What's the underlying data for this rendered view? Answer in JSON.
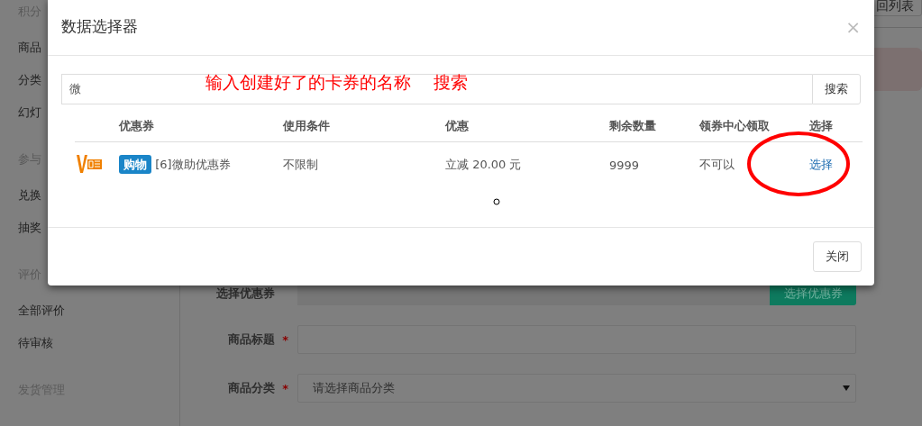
{
  "sidebar": {
    "sections": [
      {
        "title": "积分",
        "items": [
          "商品",
          "分类",
          "幻灯"
        ]
      },
      {
        "title": "参与",
        "items": [
          "兑换",
          "抽奖"
        ]
      },
      {
        "title": "评价",
        "items": [
          "全部评价",
          "待审核"
        ]
      },
      {
        "title": "发货管理"
      }
    ]
  },
  "header": {
    "back_button": "回列表"
  },
  "form": {
    "fields": [
      {
        "kind": "picker",
        "label": "选择优惠券",
        "button": "选择优惠券"
      },
      {
        "kind": "text",
        "label": "商品标题",
        "required_mark": "*"
      },
      {
        "kind": "select",
        "label": "商品分类",
        "required_mark": "*",
        "value": "请选择商品分类"
      }
    ]
  },
  "modal": {
    "title": "数据选择器",
    "close": "×",
    "search": {
      "value": "微",
      "button": "搜索"
    },
    "annotation": "输入创建好了的卡券的名称　 搜索",
    "table": {
      "columns": [
        "优惠券",
        "使用条件",
        "优惠",
        "剩余数量",
        "领券中心领取",
        "选择"
      ],
      "rows": [
        {
          "tag": "购物",
          "name": "[6]微助优惠券",
          "condition": "不限制",
          "discount": "立减 20.00 元",
          "remaining": "9999",
          "center": "不可以",
          "action": "选择",
          "highlighted": true
        }
      ]
    },
    "footer_button": "关闭"
  }
}
